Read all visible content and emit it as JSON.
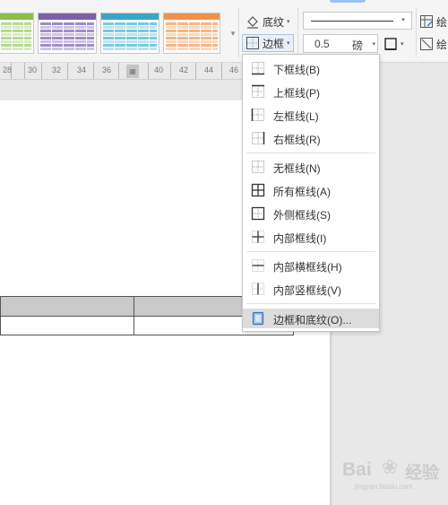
{
  "ribbon": {
    "table_styles": [
      {
        "name": "green",
        "header": "#8cbd4d",
        "row": "#b7d88f",
        "row2": "#d8ebc2"
      },
      {
        "name": "purple",
        "header": "#7b5fa8",
        "row": "#a08cc8",
        "row2": "#cdc3e3"
      },
      {
        "name": "teal",
        "header": "#3aa5c4",
        "row": "#78c7df",
        "row2": "#bfe3ef"
      },
      {
        "name": "orange",
        "header": "#f0904a",
        "row": "#f6b684",
        "row2": "#fad7bd"
      }
    ],
    "shading_label": "底纹",
    "borders_label": "边框",
    "line_weight_value": "0.5",
    "line_weight_unit": "磅",
    "draw_table_label": "绘",
    "eraser_label": "绘"
  },
  "ruler": {
    "labels": [
      "28",
      "30",
      "32",
      "34",
      "36",
      "40",
      "42",
      "44",
      "46"
    ]
  },
  "menu": {
    "items": [
      {
        "label": "下框线(B)",
        "icon": "bottom-border-icon"
      },
      {
        "label": "上框线(P)",
        "icon": "top-border-icon"
      },
      {
        "label": "左框线(L)",
        "icon": "left-border-icon"
      },
      {
        "label": "右框线(R)",
        "icon": "right-border-icon"
      },
      {
        "label": "无框线(N)",
        "icon": "no-border-icon"
      },
      {
        "label": "所有框线(A)",
        "icon": "all-borders-icon"
      },
      {
        "label": "外侧框线(S)",
        "icon": "outside-borders-icon"
      },
      {
        "label": "内部框线(I)",
        "icon": "inside-borders-icon"
      },
      {
        "label": "内部横框线(H)",
        "icon": "inside-horizontal-border-icon"
      },
      {
        "label": "内部竖框线(V)",
        "icon": "inside-vertical-border-icon"
      },
      {
        "label": "边框和底纹(O)...",
        "icon": "borders-and-shading-icon"
      }
    ],
    "highlighted_index": 10
  },
  "watermark": {
    "text_left": "Bai",
    "text_right": "经验",
    "sub": "jingyan.baidu.com"
  }
}
